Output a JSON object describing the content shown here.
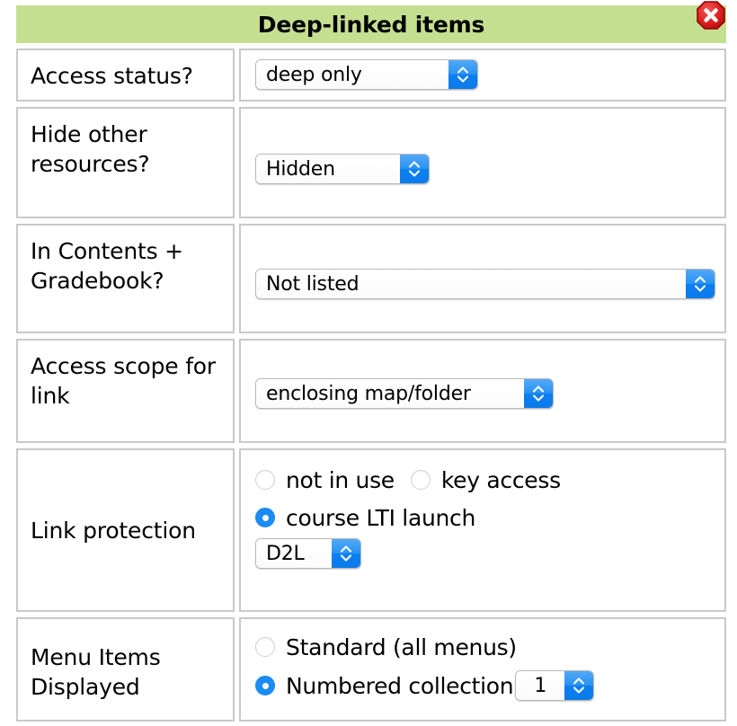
{
  "window": {
    "title": "Deep-linked items",
    "close_icon": "close-octagon-icon",
    "header_bg": "#c5df91",
    "accent": "#1b8cf5"
  },
  "rows": [
    {
      "label": "Access status?",
      "control": "select",
      "value": "deep only"
    },
    {
      "label": "Hide other resources?",
      "control": "select",
      "value": "Hidden"
    },
    {
      "label": "In Contents + Gradebook?",
      "control": "select",
      "value": "Not listed"
    },
    {
      "label": "Access scope for link",
      "control": "select",
      "value": "enclosing map/folder"
    },
    {
      "label": "Link protection",
      "control": "radio-group-with-select",
      "options": [
        {
          "label": "not in use",
          "selected": false
        },
        {
          "label": "key access",
          "selected": false
        },
        {
          "label": "course LTI launch",
          "selected": true
        }
      ],
      "select_value": "D2L"
    },
    {
      "label": "Menu Items Displayed",
      "control": "radio-group-with-number",
      "options": [
        {
          "label": "Standard (all menus)",
          "selected": false
        },
        {
          "label": "Numbered collection",
          "selected": true
        }
      ],
      "number_value": "1"
    }
  ]
}
